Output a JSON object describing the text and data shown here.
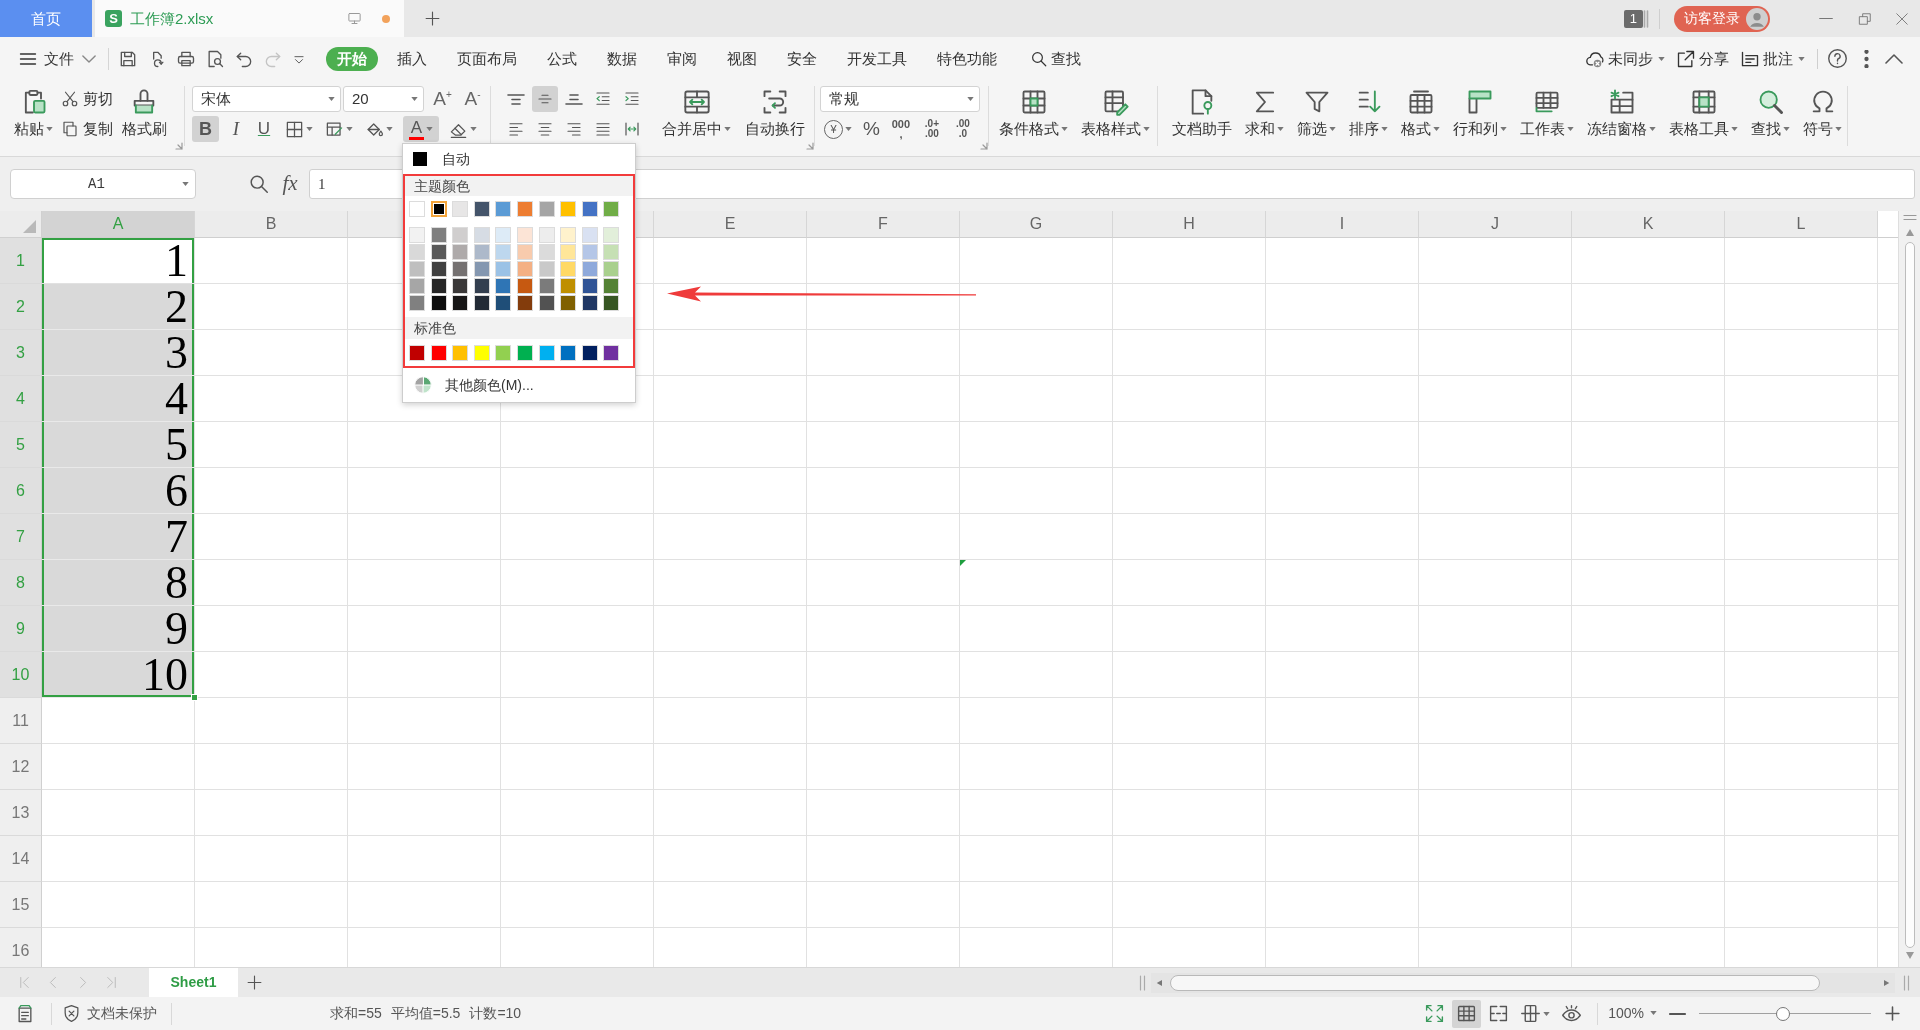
{
  "title_bar": {
    "home_tab": "首页",
    "document_tab": {
      "logo": "S",
      "name": "工作簿2.xlsx",
      "selected": true,
      "unsaved": true
    },
    "window_count": "1",
    "login_button": "访客登录"
  },
  "menu_bar": {
    "file_menu": "文件",
    "quick_access": [
      {
        "disabled": false
      },
      {
        "disabled": false
      },
      {
        "disabled": false
      },
      {
        "disabled": false
      },
      {
        "disabled": false
      },
      {
        "disabled": true
      },
      {
        "disabled": false
      }
    ],
    "tabs": [
      {
        "label": "开始",
        "selected": true
      },
      {
        "label": "插入",
        "selected": false
      },
      {
        "label": "页面布局",
        "selected": false
      },
      {
        "label": "公式",
        "selected": false
      },
      {
        "label": "数据",
        "selected": false
      },
      {
        "label": "审阅",
        "selected": false
      },
      {
        "label": "视图",
        "selected": false
      },
      {
        "label": "安全",
        "selected": false
      },
      {
        "label": "开发工具",
        "selected": false
      },
      {
        "label": "特色功能",
        "selected": false
      }
    ],
    "search": "查找",
    "actions": [
      {
        "label": "未同步",
        "dropdown": true
      },
      {
        "label": "分享",
        "dropdown": false
      },
      {
        "label": "批注",
        "dropdown": true
      }
    ]
  },
  "ribbon": {
    "clipboard": {
      "paste": {
        "label": "粘贴",
        "dropdown": true
      },
      "cut": "剪切",
      "copy": "复制",
      "format_painter": "格式刷"
    },
    "font": {
      "font_name": "宋体",
      "font_size": "20",
      "grow_font": "A$^{+}$",
      "shrink_font": "A$^{-}$",
      "styles": [
        {
          "label": "B",
          "on": true
        },
        {
          "label": "I",
          "on": false
        },
        {
          "label": "U",
          "on": false
        }
      ],
      "format_buttons": [
        {
          "dropdown": true
        },
        {
          "dropdown": true
        },
        {
          "dropdown": true
        }
      ],
      "font_color": {
        "label": "A",
        "color": "#ff0000",
        "expanded": true
      },
      "clear": {
        "dropdown": true
      }
    },
    "alignment": {
      "buttons": [
        {
          "on": false
        },
        {
          "on": true
        },
        {
          "on": false
        },
        {
          "on": false
        },
        {
          "on": false
        },
        {
          "on": false
        },
        {
          "on": false
        },
        {
          "on": false
        },
        {
          "on": false
        },
        {
          "on": false
        }
      ],
      "merge": {
        "label": "合并居中",
        "dropdown": true
      },
      "wrap": {
        "label": "自动换行",
        "dropdown": false
      }
    },
    "number": {
      "format": "常规",
      "currency": {
        "label": "¥",
        "dropdown": true
      },
      "percent": "%",
      "thousands": [
        "000",
        ","
      ],
      "increase_decimal": [
        ".0+",
        ".00"
      ],
      "decrease_decimal": [
        ".00",
        ".0"
      ]
    },
    "styles": [
      {
        "label": "条件格式",
        "dropdown": true
      },
      {
        "label": "表格样式",
        "dropdown": true
      }
    ],
    "tools": [
      {
        "label": "文档助手",
        "dropdown": false
      },
      {
        "label": "求和",
        "dropdown": true
      },
      {
        "label": "筛选",
        "dropdown": true
      },
      {
        "label": "排序",
        "dropdown": true
      },
      {
        "label": "格式",
        "dropdown": true
      },
      {
        "label": "行和列",
        "dropdown": true
      },
      {
        "label": "工作表",
        "dropdown": true
      },
      {
        "label": "冻结窗格",
        "dropdown": true
      },
      {
        "label": "表格工具",
        "dropdown": true
      },
      {
        "label": "查找",
        "dropdown": true
      },
      {
        "label": "符号",
        "dropdown": true
      }
    ]
  },
  "formula_bar": {
    "name_box": "A1",
    "function_label": "fx",
    "value": "1"
  },
  "grid": {
    "columns": [
      {
        "label": "A",
        "selected": true
      },
      {
        "label": "B",
        "selected": false
      },
      {
        "selected": false
      },
      {
        "selected": false
      },
      {
        "label": "E",
        "selected": false
      },
      {
        "label": "F",
        "selected": false
      },
      {
        "label": "G",
        "selected": false
      },
      {
        "label": "H",
        "selected": false
      },
      {
        "label": "I",
        "selected": false
      },
      {
        "label": "J",
        "selected": false
      },
      {
        "label": "K",
        "selected": false
      },
      {
        "label": "L",
        "selected": false
      }
    ],
    "rows": [
      {
        "label": "1",
        "selected": true,
        "cells": [
          {
            "value": "1",
            "selected": true,
            "active": true
          }
        ]
      },
      {
        "label": "2",
        "selected": true,
        "cells": [
          {
            "value": "2",
            "selected": true,
            "active": false
          }
        ]
      },
      {
        "label": "3",
        "selected": true,
        "cells": [
          {
            "value": "3",
            "selected": true,
            "active": false
          }
        ]
      },
      {
        "label": "4",
        "selected": true,
        "cells": [
          {
            "value": "4",
            "selected": true,
            "active": false
          }
        ]
      },
      {
        "label": "5",
        "selected": true,
        "cells": [
          {
            "value": "5",
            "selected": true,
            "active": false
          }
        ]
      },
      {
        "label": "6",
        "selected": true,
        "cells": [
          {
            "value": "6",
            "selected": true,
            "active": false
          }
        ]
      },
      {
        "label": "7",
        "selected": true,
        "cells": [
          {
            "value": "7",
            "selected": true,
            "active": false
          }
        ]
      },
      {
        "label": "8",
        "selected": true,
        "cells": [
          {
            "value": "8",
            "selected": true,
            "active": false
          },
          null,
          null,
          null,
          null,
          null,
          {
            "error_flag": true
          }
        ]
      },
      {
        "label": "9",
        "selected": true,
        "cells": [
          {
            "value": "9",
            "selected": true,
            "active": false
          }
        ]
      },
      {
        "label": "10",
        "selected": true,
        "cells": [
          {
            "value": "10",
            "selected": true,
            "active": false
          }
        ]
      },
      {
        "label": "11",
        "selected": false
      },
      {
        "label": "12",
        "selected": false
      },
      {
        "label": "13",
        "selected": false
      },
      {
        "label": "14",
        "selected": false
      },
      {
        "label": "15",
        "selected": false
      },
      {
        "label": "16",
        "selected": false
      }
    ]
  },
  "sheet_bar": {
    "nav_buttons": [
      {
        "disabled": true
      },
      {
        "disabled": true
      },
      {
        "disabled": true
      },
      {
        "disabled": true
      }
    ],
    "sheets": [
      {
        "label": "Sheet1",
        "selected": true
      }
    ]
  },
  "status_bar": {
    "protection": "文档未保护",
    "readouts": [
      "求和=55",
      "平均值=5.5",
      "计数=10"
    ],
    "views": [
      {
        "selected": false,
        "dropdown": false
      },
      {
        "selected": true,
        "dropdown": false
      },
      {
        "selected": false,
        "dropdown": false
      },
      {
        "selected": false,
        "dropdown": true
      },
      {
        "selected": false,
        "dropdown": false
      }
    ],
    "zoom": {
      "label": "100%",
      "dropdown": true
    },
    "zoom_slider": {
      "level": 0.49
    }
  },
  "color_menu": {
    "automatic": {
      "label": "自动",
      "color": "#000000"
    },
    "theme_heading": "主题颜色",
    "theme_colors": [
      {
        "color": "#ffffff",
        "selected": false
      },
      {
        "color": "#000000",
        "selected": true
      },
      {
        "color": "#e7e6e6",
        "selected": false
      },
      {
        "color": "#44546a",
        "selected": false
      },
      {
        "color": "#5b9bd5",
        "selected": false
      },
      {
        "color": "#ed7d31",
        "selected": false
      },
      {
        "color": "#a5a5a5",
        "selected": false
      },
      {
        "color": "#ffc000",
        "selected": false
      },
      {
        "color": "#4472c4",
        "selected": false
      },
      {
        "color": "#70ad47",
        "selected": false
      }
    ],
    "shade_rows": [
      {
        "swatches": [
          {
            "color": "#f2f2f2",
            "selected": false
          },
          {
            "color": "#7f7f7f",
            "selected": false
          },
          {
            "color": "#d0cece",
            "selected": false
          },
          {
            "color": "#d6dce4",
            "selected": false
          },
          {
            "color": "#ddebf7",
            "selected": false
          },
          {
            "color": "#fce4d6",
            "selected": false
          },
          {
            "color": "#ededed",
            "selected": false
          },
          {
            "color": "#fff2cc",
            "selected": false
          },
          {
            "color": "#d9e1f2",
            "selected": false
          },
          {
            "color": "#e2efda",
            "selected": false
          }
        ]
      },
      {
        "swatches": [
          {
            "color": "#d9d9d9",
            "selected": false
          },
          {
            "color": "#595959",
            "selected": false
          },
          {
            "color": "#aeaaaa",
            "selected": false
          },
          {
            "color": "#adb9ca",
            "selected": false
          },
          {
            "color": "#bdd7ee",
            "selected": false
          },
          {
            "color": "#f8cbad",
            "selected": false
          },
          {
            "color": "#dbdbdb",
            "selected": false
          },
          {
            "color": "#ffe699",
            "selected": false
          },
          {
            "color": "#b4c6e7",
            "selected": false
          },
          {
            "color": "#c6e0b4",
            "selected": false
          }
        ]
      },
      {
        "swatches": [
          {
            "color": "#bfbfbf",
            "selected": false
          },
          {
            "color": "#404040",
            "selected": false
          },
          {
            "color": "#757171",
            "selected": false
          },
          {
            "color": "#8497b0",
            "selected": false
          },
          {
            "color": "#9bc2e6",
            "selected": false
          },
          {
            "color": "#f4b084",
            "selected": false
          },
          {
            "color": "#c9c9c9",
            "selected": false
          },
          {
            "color": "#ffd966",
            "selected": false
          },
          {
            "color": "#8ea9db",
            "selected": false
          },
          {
            "color": "#a9d08e",
            "selected": false
          }
        ]
      },
      {
        "swatches": [
          {
            "color": "#a6a6a6",
            "selected": false
          },
          {
            "color": "#262626",
            "selected": false
          },
          {
            "color": "#3a3838",
            "selected": false
          },
          {
            "color": "#333f4f",
            "selected": false
          },
          {
            "color": "#2f75b5",
            "selected": false
          },
          {
            "color": "#c65911",
            "selected": false
          },
          {
            "color": "#7b7b7b",
            "selected": false
          },
          {
            "color": "#bf8f00",
            "selected": false
          },
          {
            "color": "#305496",
            "selected": false
          },
          {
            "color": "#548235",
            "selected": false
          }
        ]
      },
      {
        "swatches": [
          {
            "color": "#808080",
            "selected": false
          },
          {
            "color": "#0d0d0d",
            "selected": false
          },
          {
            "color": "#171616",
            "selected": false
          },
          {
            "color": "#222a35",
            "selected": false
          },
          {
            "color": "#1f4e78",
            "selected": false
          },
          {
            "color": "#833c0c",
            "selected": false
          },
          {
            "color": "#525252",
            "selected": false
          },
          {
            "color": "#806000",
            "selected": false
          },
          {
            "color": "#203764",
            "selected": false
          },
          {
            "color": "#375623",
            "selected": false
          }
        ]
      }
    ],
    "standard_heading": "标准色",
    "standard_colors": [
      {
        "color": "#c00000",
        "selected": false
      },
      {
        "color": "#ff0000",
        "selected": false
      },
      {
        "color": "#ffc000",
        "selected": false
      },
      {
        "color": "#ffff00",
        "selected": false
      },
      {
        "color": "#92d050",
        "selected": false
      },
      {
        "color": "#00b050",
        "selected": false
      },
      {
        "color": "#00b0f0",
        "selected": false
      },
      {
        "color": "#0070c0",
        "selected": false
      },
      {
        "color": "#002060",
        "selected": false
      },
      {
        "color": "#7030a0",
        "selected": false
      }
    ],
    "more_colors": "其他颜色(M)..."
  },
  "annotations": {
    "palette_frame": true,
    "pointer_arrow": true
  }
}
